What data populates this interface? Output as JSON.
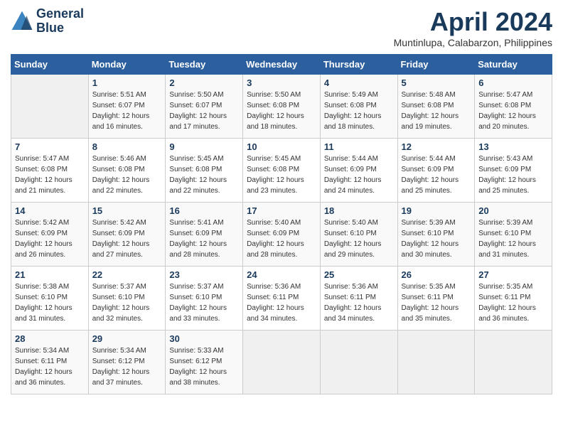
{
  "header": {
    "logo_line1": "General",
    "logo_line2": "Blue",
    "month_year": "April 2024",
    "location": "Muntinlupa, Calabarzon, Philippines"
  },
  "weekdays": [
    "Sunday",
    "Monday",
    "Tuesday",
    "Wednesday",
    "Thursday",
    "Friday",
    "Saturday"
  ],
  "weeks": [
    [
      {
        "day": "",
        "empty": true
      },
      {
        "day": "1",
        "sunrise": "5:51 AM",
        "sunset": "6:07 PM",
        "daylight": "12 hours and 16 minutes."
      },
      {
        "day": "2",
        "sunrise": "5:50 AM",
        "sunset": "6:07 PM",
        "daylight": "12 hours and 17 minutes."
      },
      {
        "day": "3",
        "sunrise": "5:50 AM",
        "sunset": "6:08 PM",
        "daylight": "12 hours and 18 minutes."
      },
      {
        "day": "4",
        "sunrise": "5:49 AM",
        "sunset": "6:08 PM",
        "daylight": "12 hours and 18 minutes."
      },
      {
        "day": "5",
        "sunrise": "5:48 AM",
        "sunset": "6:08 PM",
        "daylight": "12 hours and 19 minutes."
      },
      {
        "day": "6",
        "sunrise": "5:47 AM",
        "sunset": "6:08 PM",
        "daylight": "12 hours and 20 minutes."
      }
    ],
    [
      {
        "day": "7",
        "sunrise": "5:47 AM",
        "sunset": "6:08 PM",
        "daylight": "12 hours and 21 minutes."
      },
      {
        "day": "8",
        "sunrise": "5:46 AM",
        "sunset": "6:08 PM",
        "daylight": "12 hours and 22 minutes."
      },
      {
        "day": "9",
        "sunrise": "5:45 AM",
        "sunset": "6:08 PM",
        "daylight": "12 hours and 22 minutes."
      },
      {
        "day": "10",
        "sunrise": "5:45 AM",
        "sunset": "6:08 PM",
        "daylight": "12 hours and 23 minutes."
      },
      {
        "day": "11",
        "sunrise": "5:44 AM",
        "sunset": "6:09 PM",
        "daylight": "12 hours and 24 minutes."
      },
      {
        "day": "12",
        "sunrise": "5:44 AM",
        "sunset": "6:09 PM",
        "daylight": "12 hours and 25 minutes."
      },
      {
        "day": "13",
        "sunrise": "5:43 AM",
        "sunset": "6:09 PM",
        "daylight": "12 hours and 25 minutes."
      }
    ],
    [
      {
        "day": "14",
        "sunrise": "5:42 AM",
        "sunset": "6:09 PM",
        "daylight": "12 hours and 26 minutes."
      },
      {
        "day": "15",
        "sunrise": "5:42 AM",
        "sunset": "6:09 PM",
        "daylight": "12 hours and 27 minutes."
      },
      {
        "day": "16",
        "sunrise": "5:41 AM",
        "sunset": "6:09 PM",
        "daylight": "12 hours and 28 minutes."
      },
      {
        "day": "17",
        "sunrise": "5:40 AM",
        "sunset": "6:09 PM",
        "daylight": "12 hours and 28 minutes."
      },
      {
        "day": "18",
        "sunrise": "5:40 AM",
        "sunset": "6:10 PM",
        "daylight": "12 hours and 29 minutes."
      },
      {
        "day": "19",
        "sunrise": "5:39 AM",
        "sunset": "6:10 PM",
        "daylight": "12 hours and 30 minutes."
      },
      {
        "day": "20",
        "sunrise": "5:39 AM",
        "sunset": "6:10 PM",
        "daylight": "12 hours and 31 minutes."
      }
    ],
    [
      {
        "day": "21",
        "sunrise": "5:38 AM",
        "sunset": "6:10 PM",
        "daylight": "12 hours and 31 minutes."
      },
      {
        "day": "22",
        "sunrise": "5:37 AM",
        "sunset": "6:10 PM",
        "daylight": "12 hours and 32 minutes."
      },
      {
        "day": "23",
        "sunrise": "5:37 AM",
        "sunset": "6:10 PM",
        "daylight": "12 hours and 33 minutes."
      },
      {
        "day": "24",
        "sunrise": "5:36 AM",
        "sunset": "6:11 PM",
        "daylight": "12 hours and 34 minutes."
      },
      {
        "day": "25",
        "sunrise": "5:36 AM",
        "sunset": "6:11 PM",
        "daylight": "12 hours and 34 minutes."
      },
      {
        "day": "26",
        "sunrise": "5:35 AM",
        "sunset": "6:11 PM",
        "daylight": "12 hours and 35 minutes."
      },
      {
        "day": "27",
        "sunrise": "5:35 AM",
        "sunset": "6:11 PM",
        "daylight": "12 hours and 36 minutes."
      }
    ],
    [
      {
        "day": "28",
        "sunrise": "5:34 AM",
        "sunset": "6:11 PM",
        "daylight": "12 hours and 36 minutes."
      },
      {
        "day": "29",
        "sunrise": "5:34 AM",
        "sunset": "6:12 PM",
        "daylight": "12 hours and 37 minutes."
      },
      {
        "day": "30",
        "sunrise": "5:33 AM",
        "sunset": "6:12 PM",
        "daylight": "12 hours and 38 minutes."
      },
      {
        "day": "",
        "empty": true
      },
      {
        "day": "",
        "empty": true
      },
      {
        "day": "",
        "empty": true
      },
      {
        "day": "",
        "empty": true
      }
    ]
  ]
}
